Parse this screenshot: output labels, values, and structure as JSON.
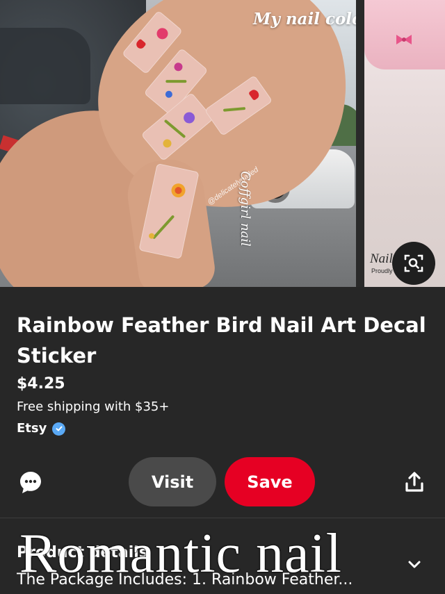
{
  "hero": {
    "overlay_title": "My nail color scheme",
    "watermark_handle": "@delicatelynailed",
    "watermark_signature": "Coffgirl nail",
    "side_brand": "Nailog",
    "side_brand_sub": "Proudly ... d F"
  },
  "lens_button": {
    "icon": "visual-search-icon"
  },
  "product": {
    "title": "Rainbow Feather Bird Nail Art Decal Sticker",
    "price": "$4.25",
    "shipping": "Free shipping with $35+",
    "merchant": "Etsy",
    "verified_icon": "verified-check-icon"
  },
  "actions": {
    "comment_icon": "comment-icon",
    "visit_label": "Visit",
    "save_label": "Save",
    "share_icon": "share-icon"
  },
  "details": {
    "heading": "Product details",
    "text": "The Package Includes: 1. Rainbow Feather...",
    "chevron_icon": "chevron-down-icon"
  },
  "overlay_caption": "Romantic nail",
  "colors": {
    "background": "#272727",
    "save_button": "#e60023",
    "visit_button": "#4a4a4a",
    "verified": "#5aa9f5"
  }
}
